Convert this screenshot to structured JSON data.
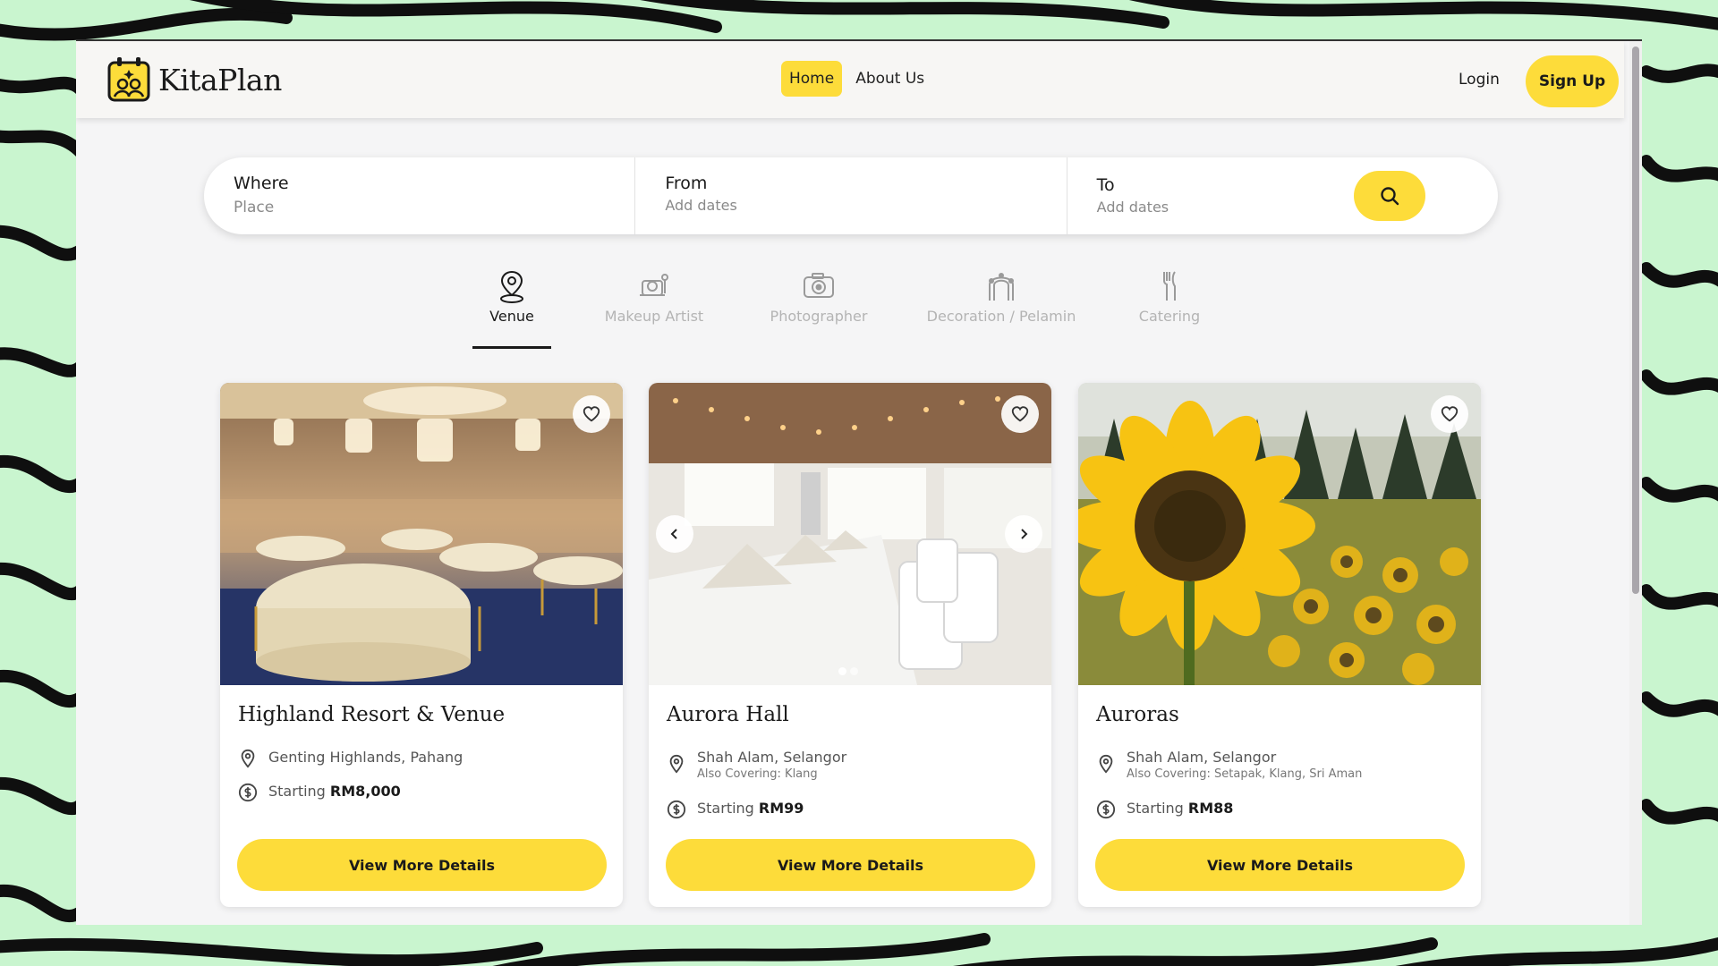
{
  "app": {
    "name": "KitaPlan"
  },
  "nav": {
    "links": [
      {
        "label": "Home",
        "active": true
      },
      {
        "label": "About Us",
        "active": false
      }
    ],
    "login_label": "Login",
    "signup_label": "Sign Up"
  },
  "search": {
    "where": {
      "label": "Where",
      "placeholder": "Place"
    },
    "from": {
      "label": "From",
      "placeholder": "Add dates"
    },
    "to": {
      "label": "To",
      "placeholder": "Add dates"
    },
    "button_icon": "search-icon"
  },
  "categories": [
    {
      "label": "Venue",
      "icon": "venue-pin-icon",
      "active": true
    },
    {
      "label": "Makeup Artist",
      "icon": "makeup-mirror-icon",
      "active": false
    },
    {
      "label": "Photographer",
      "icon": "camera-icon",
      "active": false
    },
    {
      "label": "Decoration / Pelamin",
      "icon": "arch-icon",
      "active": false
    },
    {
      "label": "Catering",
      "icon": "cutlery-icon",
      "active": false
    }
  ],
  "cards": [
    {
      "title": "Highland Resort & Venue",
      "location": "Genting Highlands, Pahang",
      "also_covering": "",
      "price_prefix": "Starting",
      "price": "RM8,000",
      "button_label": "View More Details",
      "image": "ballroom-photo"
    },
    {
      "title": "Aurora Hall",
      "location": "Shah Alam, Selangor",
      "also_covering": "Also Covering: Klang",
      "price_prefix": "Starting",
      "price": "RM99",
      "button_label": "View More Details",
      "image": "banquet-table-photo",
      "carousel": {
        "slides": 2,
        "current": 1
      }
    },
    {
      "title": "Auroras",
      "location": "Shah Alam, Selangor",
      "also_covering": "Also Covering: Setapak, Klang, Sri Aman",
      "price_prefix": "Starting",
      "price": "RM88",
      "button_label": "View More Details",
      "image": "sunflower-photo"
    }
  ],
  "colors": {
    "accent": "#fddc3a",
    "page_bg": "#f5f5f6",
    "outer_bg": "#c9f5cf"
  }
}
